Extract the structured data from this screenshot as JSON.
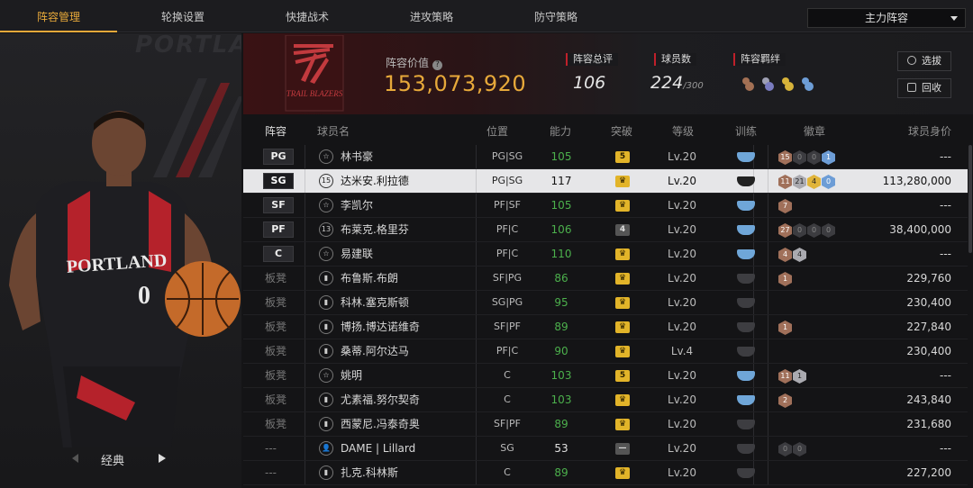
{
  "tabs": [
    "阵容管理",
    "轮换设置",
    "快捷战术",
    "进攻策略",
    "防守策略"
  ],
  "active_tab": 0,
  "lineup_select": "主力阵容",
  "left_panel": {
    "bg_text": "PORTLAN",
    "jersey_text": "PORTLAND",
    "jersey_number": "0",
    "variant_label": "经典"
  },
  "summary": {
    "logo_text": "TRAIL BLAZERS",
    "value_label": "阵容价值",
    "value": "153,073,920",
    "total_rating_label": "阵容总评",
    "total_rating": "106",
    "player_count_label": "球员数",
    "player_count": "224",
    "player_count_max": "/300",
    "bond_label": "阵容羁绊",
    "btn_select": "选拔",
    "btn_recycle": "回收"
  },
  "columns": {
    "lineup": "阵容",
    "name": "球员名",
    "position": "位置",
    "ability": "能力",
    "breakthrough": "突破",
    "level": "等级",
    "training": "训练",
    "badge": "徽章",
    "price": "球员身价"
  },
  "rows": [
    {
      "slot": "PG",
      "type": "☆",
      "name": "林书豪",
      "pos": "PG|SG",
      "ability": "105",
      "ab_color": "green",
      "brk": "5",
      "brk_style": "gold",
      "level": "Lv.20",
      "train": "blue",
      "badges": [
        [
          "15",
          "br"
        ],
        [
          "0",
          "dk"
        ],
        [
          "0",
          "dk"
        ],
        [
          "1",
          "bl"
        ]
      ],
      "price": "---"
    },
    {
      "slot": "SG",
      "type": "15",
      "name": "达米安.利拉德",
      "pos": "PG|SG",
      "ability": "117",
      "ab_color": "white",
      "brk": "♛",
      "brk_style": "gold",
      "level": "Lv.20",
      "train": "dark",
      "badges": [
        [
          "11",
          "br"
        ],
        [
          "21",
          "sv"
        ],
        [
          "4",
          "gd"
        ],
        [
          "0",
          "bl"
        ]
      ],
      "price": "113,280,000",
      "selected": true
    },
    {
      "slot": "SF",
      "type": "☆",
      "name": "李凯尔",
      "pos": "PF|SF",
      "ability": "105",
      "ab_color": "green",
      "brk": "♛",
      "brk_style": "gold",
      "level": "Lv.20",
      "train": "blue",
      "badges": [
        [
          "7",
          "br"
        ]
      ],
      "price": "---"
    },
    {
      "slot": "PF",
      "type": "13",
      "name": "布莱克.格里芬",
      "pos": "PF|C",
      "ability": "106",
      "ab_color": "green",
      "brk": "4",
      "brk_style": "gray",
      "level": "Lv.20",
      "train": "blue",
      "badges": [
        [
          "27",
          "br"
        ],
        [
          "0",
          "dk"
        ],
        [
          "0",
          "dk"
        ],
        [
          "0",
          "dk"
        ]
      ],
      "price": "38,400,000"
    },
    {
      "slot": "C",
      "type": "☆",
      "name": "易建联",
      "pos": "PF|C",
      "ability": "110",
      "ab_color": "green",
      "brk": "♛",
      "brk_style": "gold",
      "level": "Lv.20",
      "train": "blue",
      "badges": [
        [
          "4",
          "br"
        ],
        [
          "4",
          "sv"
        ]
      ],
      "price": "---"
    },
    {
      "slot": "板凳",
      "type": "▮",
      "name": "布鲁斯.布朗",
      "pos": "SF|PG",
      "ability": "86",
      "ab_color": "green",
      "brk": "♛",
      "brk_style": "gold",
      "level": "Lv.20",
      "train": "dark",
      "badges": [
        [
          "1",
          "br"
        ]
      ],
      "price": "229,760"
    },
    {
      "slot": "板凳",
      "type": "▮",
      "name": "科林.塞克斯顿",
      "pos": "SG|PG",
      "ability": "95",
      "ab_color": "green",
      "brk": "♛",
      "brk_style": "gold",
      "level": "Lv.20",
      "train": "dark",
      "badges": [],
      "price": "230,400"
    },
    {
      "slot": "板凳",
      "type": "▮",
      "name": "博扬.博达诺维奇",
      "pos": "SF|PF",
      "ability": "89",
      "ab_color": "green",
      "brk": "♛",
      "brk_style": "gold",
      "level": "Lv.20",
      "train": "dark",
      "badges": [
        [
          "1",
          "br"
        ]
      ],
      "price": "227,840"
    },
    {
      "slot": "板凳",
      "type": "▮",
      "name": "桑蒂.阿尔达马",
      "pos": "PF|C",
      "ability": "90",
      "ab_color": "green",
      "brk": "♛",
      "brk_style": "gold",
      "level": "Lv.4",
      "train": "dark",
      "badges": [],
      "price": "230,400"
    },
    {
      "slot": "板凳",
      "type": "☆",
      "name": "姚明",
      "pos": "C",
      "ability": "103",
      "ab_color": "green",
      "brk": "5",
      "brk_style": "gold",
      "level": "Lv.20",
      "train": "blue",
      "badges": [
        [
          "11",
          "br"
        ],
        [
          "1",
          "sv"
        ]
      ],
      "price": "---"
    },
    {
      "slot": "板凳",
      "type": "▮",
      "name": "尤素福.努尔契奇",
      "pos": "C",
      "ability": "103",
      "ab_color": "green",
      "brk": "♛",
      "brk_style": "gold",
      "level": "Lv.20",
      "train": "blue",
      "badges": [
        [
          "2",
          "br"
        ]
      ],
      "price": "243,840"
    },
    {
      "slot": "板凳",
      "type": "▮",
      "name": "西蒙尼.冯泰奇奥",
      "pos": "SF|PF",
      "ability": "89",
      "ab_color": "green",
      "brk": "♛",
      "brk_style": "gold",
      "level": "Lv.20",
      "train": "dark",
      "badges": [],
      "price": "231,680"
    },
    {
      "slot": "---",
      "type": "👤",
      "name": "DAME | Lillard",
      "pos": "SG",
      "ability": "53",
      "ab_color": "white",
      "brk": "—",
      "brk_style": "gray",
      "level": "Lv.20",
      "train": "dark",
      "badges": [
        [
          "0",
          "dk"
        ],
        [
          "0",
          "dk"
        ]
      ],
      "price": "---"
    },
    {
      "slot": "---",
      "type": "▮",
      "name": "扎克.科林斯",
      "pos": "C",
      "ability": "89",
      "ab_color": "green",
      "brk": "♛",
      "brk_style": "gold",
      "level": "Lv.20",
      "train": "dark",
      "badges": [],
      "price": "227,200"
    }
  ]
}
